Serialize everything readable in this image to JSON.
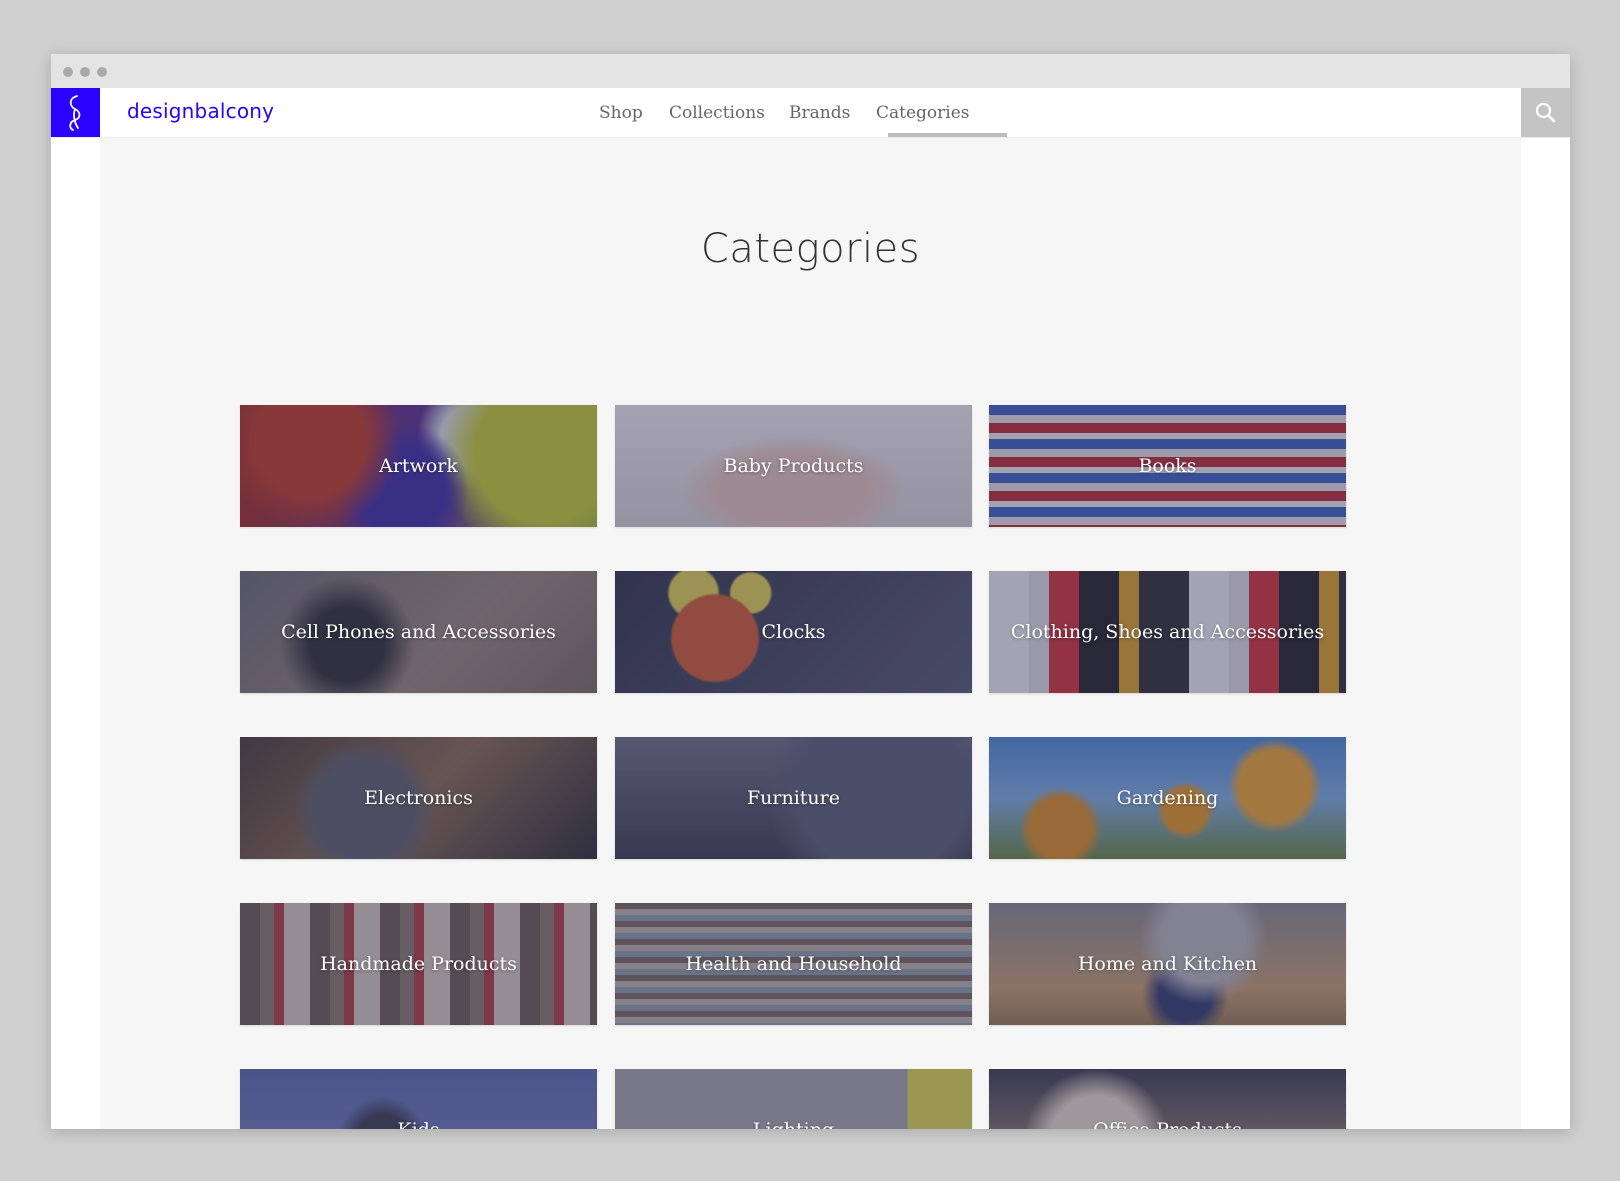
{
  "brand": {
    "name": "designbalcony"
  },
  "nav": {
    "items": [
      {
        "label": "Shop"
      },
      {
        "label": "Collections"
      },
      {
        "label": "Brands"
      },
      {
        "label": "Categories"
      }
    ],
    "active": "Categories"
  },
  "search": {
    "icon": "search-icon"
  },
  "page": {
    "title": "Categories"
  },
  "categories": [
    {
      "label": "Artwork"
    },
    {
      "label": "Baby Products"
    },
    {
      "label": "Books"
    },
    {
      "label": "Cell Phones and Accessories"
    },
    {
      "label": "Clocks"
    },
    {
      "label": "Clothing, Shoes and Accessories"
    },
    {
      "label": "Electronics"
    },
    {
      "label": "Furniture"
    },
    {
      "label": "Gardening"
    },
    {
      "label": "Handmade Products"
    },
    {
      "label": "Health and Household"
    },
    {
      "label": "Home and Kitchen"
    },
    {
      "label": "Kids"
    },
    {
      "label": "Lighting"
    },
    {
      "label": "Office Products"
    }
  ],
  "colors": {
    "brand": "#2a00ff",
    "page_background": "#f6f6f6",
    "tile_overlay": "#37375f"
  }
}
